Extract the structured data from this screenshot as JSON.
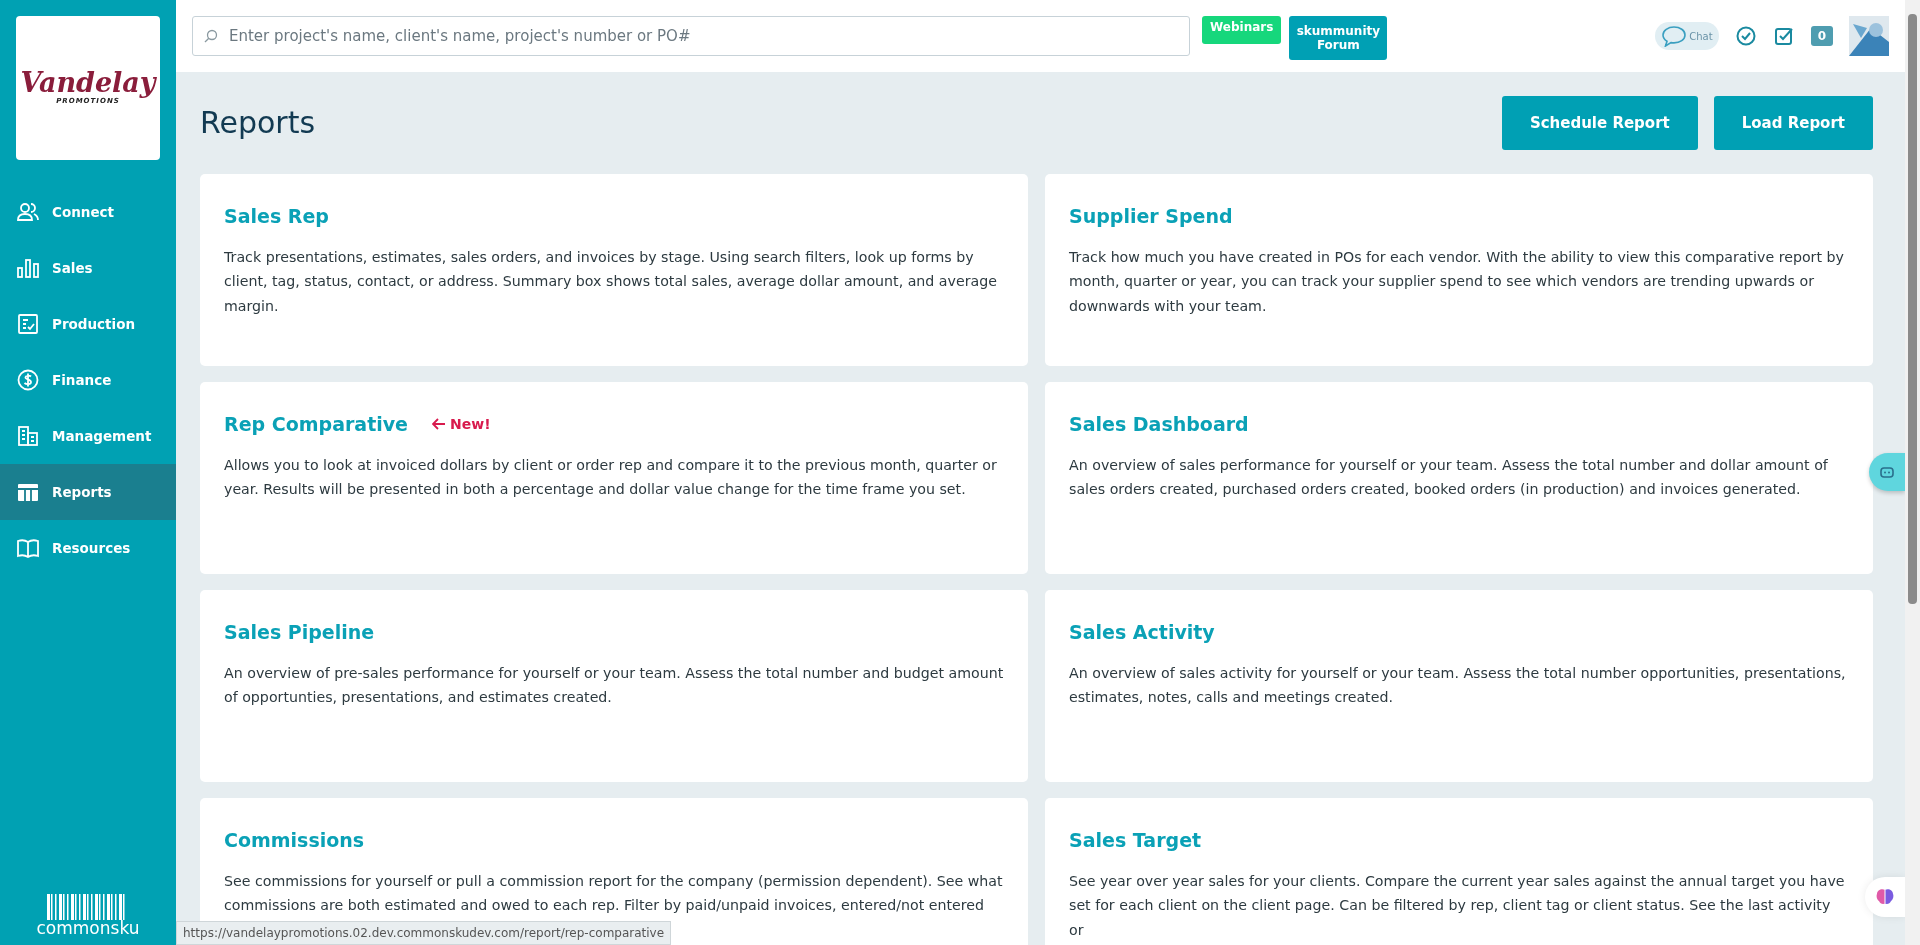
{
  "logo": {
    "script": "Vandelay",
    "subtitle": "PROMOTIONS"
  },
  "sidebar": {
    "items": [
      {
        "label": "Connect",
        "selected": false
      },
      {
        "label": "Sales",
        "selected": false
      },
      {
        "label": "Production",
        "selected": false
      },
      {
        "label": "Finance",
        "selected": false
      },
      {
        "label": "Management",
        "selected": false
      },
      {
        "label": "Reports",
        "selected": true
      },
      {
        "label": "Resources",
        "selected": false
      }
    ],
    "brand": "commonsku"
  },
  "topbar": {
    "search": {
      "placeholder": "Enter project's name, client's name, project's number or PO#"
    },
    "links": [
      {
        "label": "Webinars",
        "color": "#16d77c"
      },
      {
        "label": "skummunity Forum",
        "color": "#00a0b4"
      }
    ],
    "chat_label": "Chat",
    "count_badge": "0"
  },
  "page": {
    "title": "Reports",
    "buttons": [
      "Schedule Report",
      "Load Report"
    ]
  },
  "cards": [
    {
      "title": "Sales Rep",
      "description": "Track presentations, estimates, sales orders, and invoices by stage. Using search filters, look up forms by client, tag, status, contact, or address. Summary box shows total sales, average dollar amount, and average margin."
    },
    {
      "title": "Supplier Spend",
      "description": "Track how much you have created in POs for each vendor. With the ability to view this comparative report by month, quarter or year, you can track your supplier spend to see which vendors are trending upwards or downwards with your team."
    },
    {
      "title": "Rep Comparative",
      "tag": "New!",
      "description": "Allows you to look at invoiced dollars by client or order rep and compare it to the previous month, quarter or year. Results will be presented in both a percentage and dollar value change for the time frame you set."
    },
    {
      "title": "Sales Dashboard",
      "description": "An overview of sales performance for yourself or your team. Assess the total number and dollar amount of sales orders created, purchased orders created, booked orders (in production) and invoices generated."
    },
    {
      "title": "Sales Pipeline",
      "description": "An overview of pre-sales performance for yourself or your team. Assess the total number and budget amount of opportunties, presentations, and estimates created."
    },
    {
      "title": "Sales Activity",
      "description": "An overview of sales activity for yourself or your team. Assess the total number opportunities, presentations, estimates, notes, calls and meetings created."
    },
    {
      "title": "Commissions",
      "description": "See commissions for yourself or pull a commission report for the company (permission dependent). See what commissions are both estimated and owed to each rep. Filter by paid/unpaid invoices, entered/not entered"
    },
    {
      "title": "Sales Target",
      "description": "See year over year sales for your clients. Compare the current year sales against the annual target you have set for each client on the client page. Can be filtered by rep, client tag or client status. See the last activity or"
    }
  ],
  "status_bar": {
    "url": "https://vandelaypromotions.02.dev.commonskudev.com/report/rep-comparative"
  }
}
